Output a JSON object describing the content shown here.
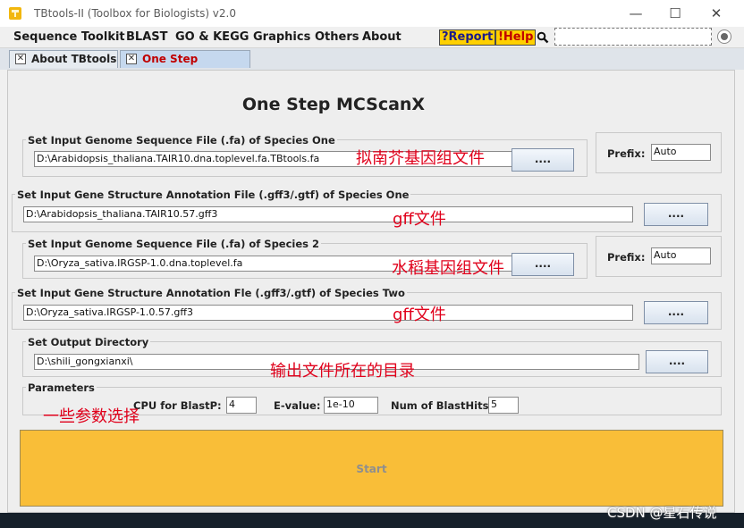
{
  "window": {
    "title": "TBtools-II (Toolbox for Biologists) v2.0",
    "controls": [
      "—",
      "☐",
      "✕"
    ]
  },
  "menubar": {
    "items": [
      "Sequence Toolkit",
      "BLAST",
      "GO & KEGG",
      "Graphics",
      "Others",
      "About"
    ],
    "report_label": "?Report",
    "help_label": "!Help"
  },
  "tabs": [
    {
      "label": "About TBtools",
      "active": false
    },
    {
      "label": "One Step MCScanX",
      "active": true
    }
  ],
  "page": {
    "title": "One Step MCScanX",
    "groups": {
      "genome1": {
        "label": "Set Input Genome Sequence File (.fa) of Species One",
        "value": "D:\\Arabidopsis_thaliana.TAIR10.dna.toplevel.fa.TBtools.fa",
        "button": "....",
        "annotation": "拟南芥基因组文件"
      },
      "prefix1": {
        "label": "Prefix:",
        "value": "Auto"
      },
      "gff1": {
        "label": "Set Input Gene Structure Annotation File (.gff3/.gtf) of Species One",
        "value": "D:\\Arabidopsis_thaliana.TAIR10.57.gff3",
        "button": "....",
        "annotation": "gff文件"
      },
      "genome2": {
        "label": "Set Input Genome Sequence File (.fa) of Species 2",
        "value": "D:\\Oryza_sativa.IRGSP-1.0.dna.toplevel.fa",
        "button": "....",
        "annotation": "水稻基因组文件"
      },
      "prefix2": {
        "label": "Prefix:",
        "value": "Auto"
      },
      "gff2": {
        "label": "Set Input Gene Structure Annotation Fle (.gff3/.gtf) of Species Two",
        "value": "D:\\Oryza_sativa.IRGSP-1.0.57.gff3",
        "button": "....",
        "annotation": "gff文件"
      },
      "output": {
        "label": "Set Output Directory",
        "value": "D:\\shili_gongxianxi\\",
        "button": "....",
        "annotation": "输出文件所在的目录"
      },
      "params": {
        "label": "Parameters",
        "annotation": "一些参数选择",
        "cpu_label": "CPU for BlastP:",
        "cpu_value": "4",
        "evalue_label": "E-value:",
        "evalue_value": "1e-10",
        "hits_label": "Num of BlastHits:",
        "hits_value": "5"
      }
    },
    "start_label": "Start"
  },
  "watermark": "CSDN @星石传说",
  "colors": {
    "start_bg": "#f9be38",
    "annotation": "#e0001b",
    "highlight": "#ffd000"
  }
}
